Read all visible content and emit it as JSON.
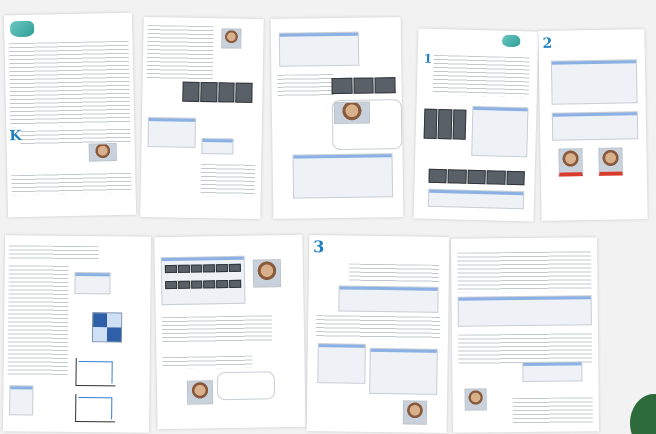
{
  "sheets": [
    {
      "id": "p1",
      "title": "",
      "step": ""
    },
    {
      "id": "p2",
      "title": "",
      "step": ""
    },
    {
      "id": "p3",
      "title": "",
      "step": ""
    },
    {
      "id": "p4",
      "title": "",
      "step": "1"
    },
    {
      "id": "p5",
      "title": "",
      "step": "2"
    },
    {
      "id": "p6",
      "title": "",
      "step": ""
    },
    {
      "id": "p7",
      "title": "",
      "step": ""
    },
    {
      "id": "p8",
      "title": "",
      "step": "3"
    },
    {
      "id": "p9",
      "title": "",
      "step": ""
    }
  ],
  "colors": {
    "accent": "#1f7fc2",
    "mask": "#3db6b0",
    "corner": "#2e6b3a"
  }
}
